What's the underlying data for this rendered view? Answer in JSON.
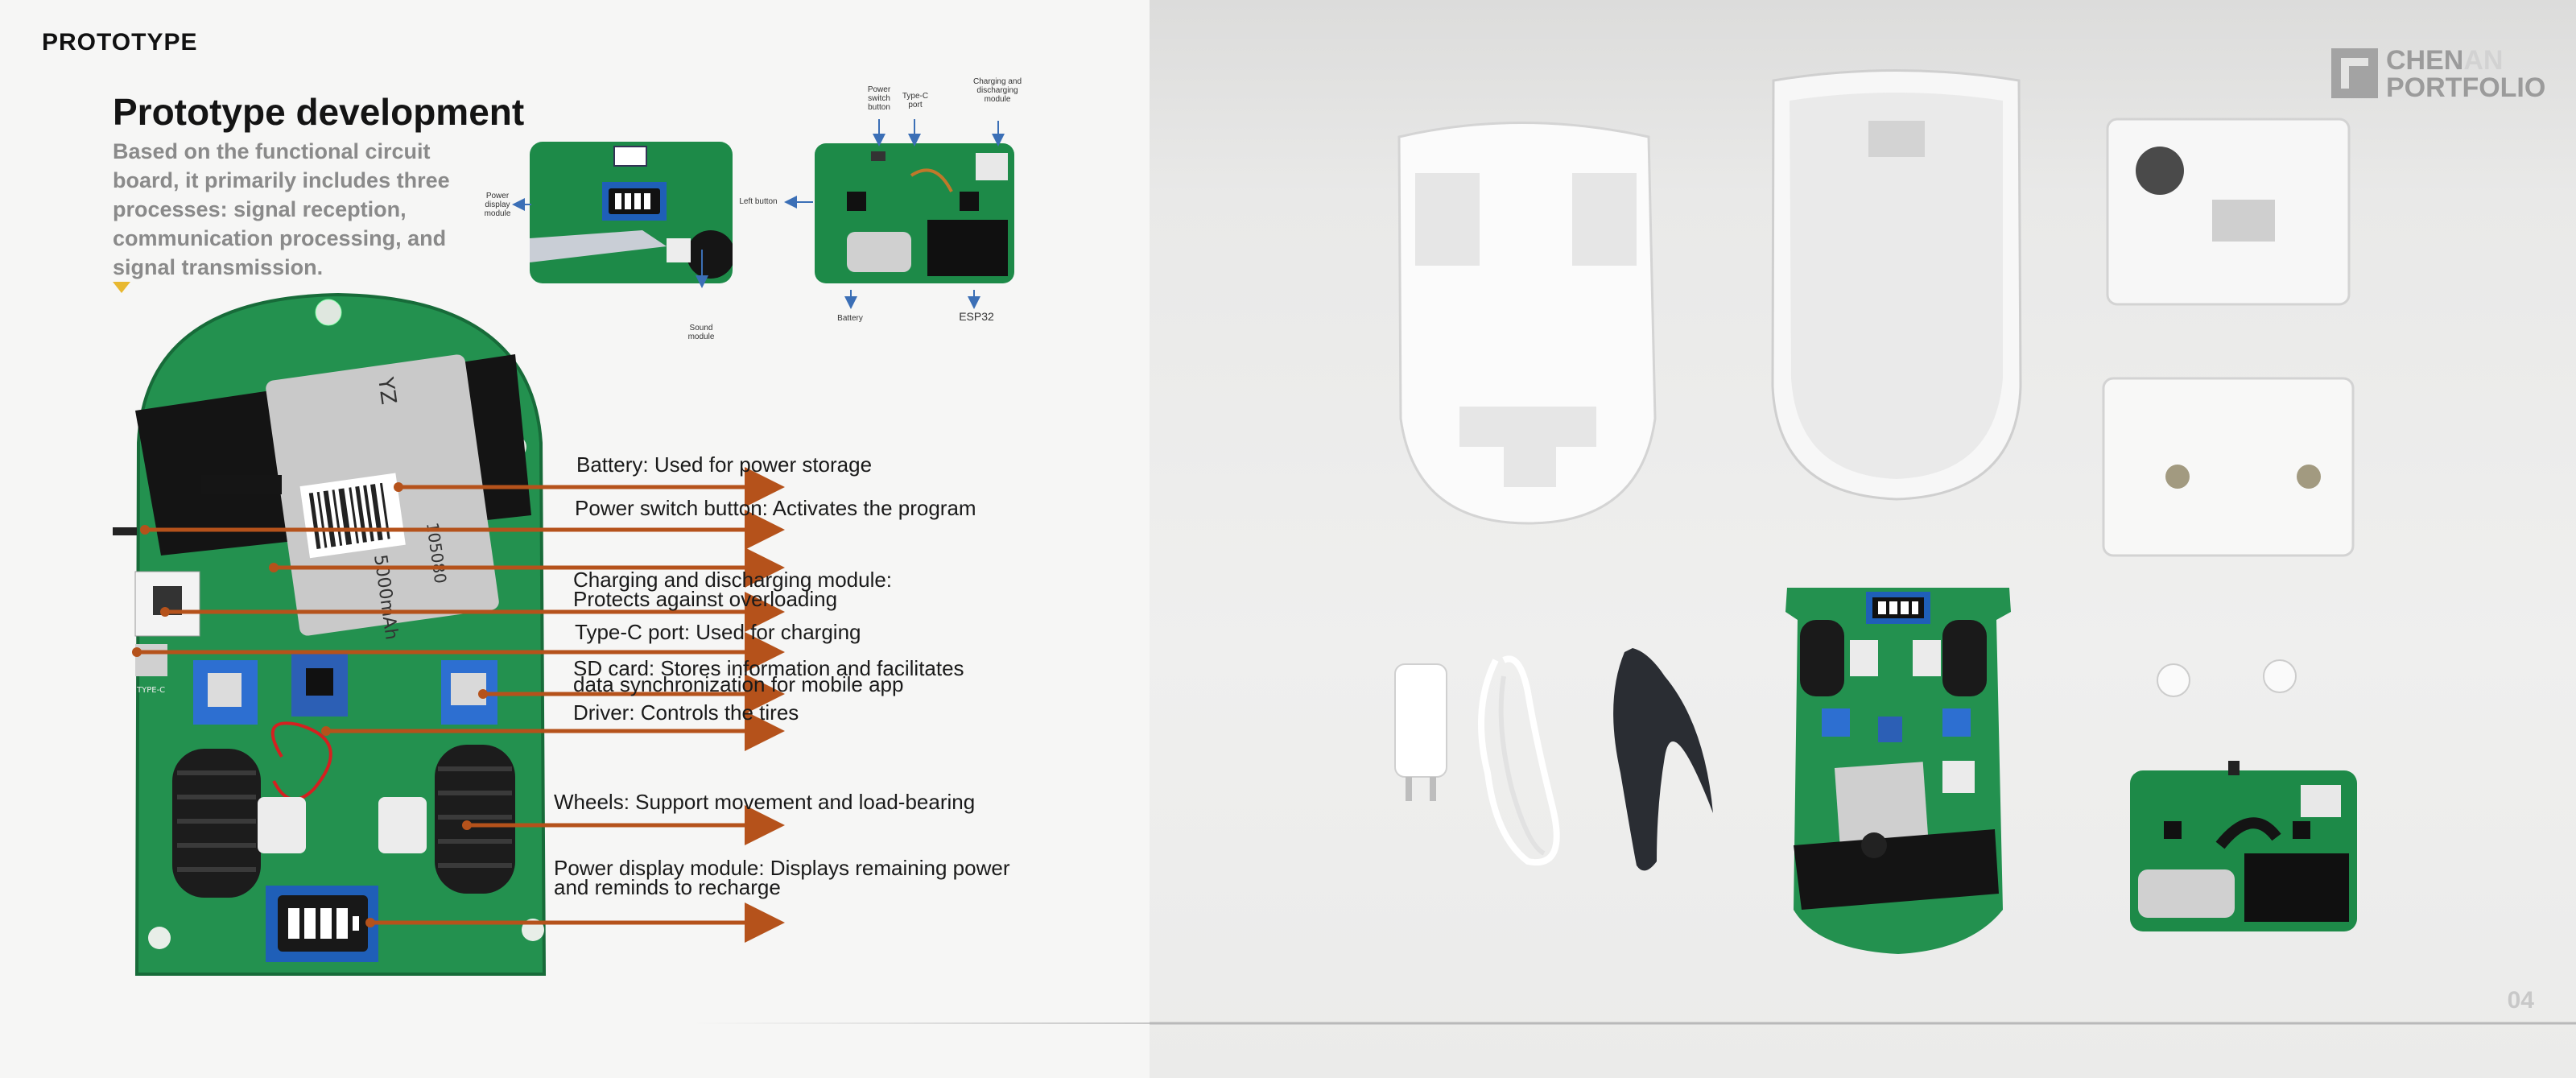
{
  "header": {
    "section": "PROTOTYPE",
    "page_number": "04"
  },
  "intro": {
    "title": "Prototype development",
    "description": "Based on the functional circuit board, it primarily includes three processes: signal reception, communication processing, and signal transmission."
  },
  "callouts": [
    "Battery: Used for power storage",
    "Power switch button: Activates the program",
    "Charging and discharging module:",
    "Protects against overloading",
    "Type-C port: Used for charging",
    "SD card: Stores information and facilitates",
    "data synchronization for mobile app",
    "Driver: Controls the tires",
    "Wheels: Support movement and load-bearing",
    "Power display module: Displays remaining power",
    "and reminds to recharge"
  ],
  "detail_labels": {
    "power_display": "Power display module",
    "sound": "Sound module",
    "left_button": "Left button",
    "power_switch": "Power switch button",
    "type_c": "Type-C port",
    "charging": "Charging and discharging module",
    "battery": "Battery",
    "esp32": "ESP32"
  },
  "board_prints": {
    "battery_capacity": "5000mAh",
    "battery_model": "105080",
    "battery_tag": "YZ",
    "typec_silk": "TYPE-C"
  },
  "logo": {
    "line1_a": "CHEN",
    "line1_b": "AN",
    "line2": "PORTFOLIO"
  },
  "colors": {
    "accent_orange": "#b5521b",
    "pcb_green": "#1f8a4d",
    "marker_yellow": "#e8b830",
    "label_blue": "#3b6fb6"
  }
}
